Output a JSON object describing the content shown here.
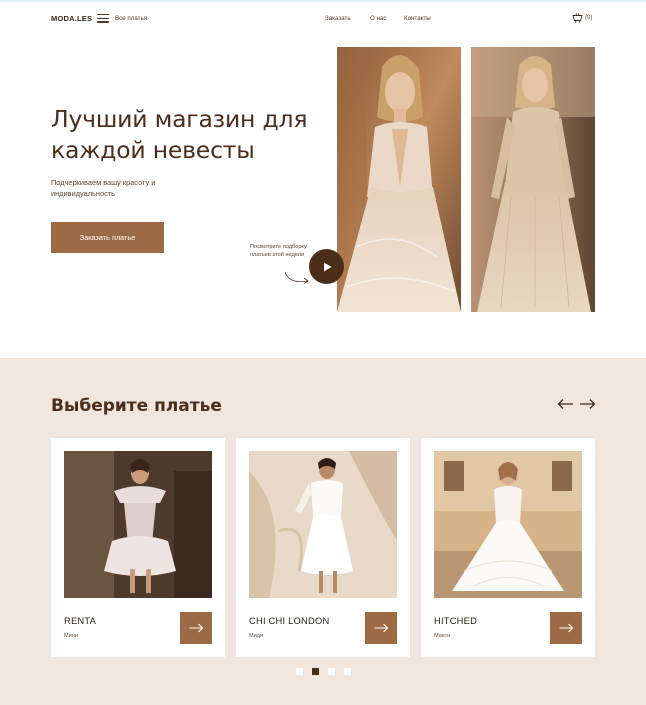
{
  "header": {
    "logo": "MODA.LES",
    "menu_label": "Все платья",
    "nav": [
      "Заказать",
      "О нас",
      "Контакты"
    ],
    "cart_count": "(0)"
  },
  "hero": {
    "title": "Лучший магазин для каждой невесты",
    "subtitle": "Подчеркиваем вашу красоту и индивидуальность",
    "cta_label": "Заказать платье",
    "video_note": "Посмотрите подборку платьев этой недели"
  },
  "catalog": {
    "title": "Выберите платье",
    "cards": [
      {
        "name": "RENTA",
        "type": "Мини"
      },
      {
        "name": "CHI CHI LONDON",
        "type": "Миди"
      },
      {
        "name": "HITCHED",
        "type": "Макси"
      }
    ],
    "pagination": {
      "total": 4,
      "active_index": 1
    }
  },
  "colors": {
    "accent": "#9c6a45",
    "dark_brown": "#4a2e1b",
    "section_bg": "#f0e6dd"
  },
  "icons": [
    "menu-icon",
    "cart-icon",
    "play-icon",
    "arrow-left-icon",
    "arrow-right-icon"
  ]
}
